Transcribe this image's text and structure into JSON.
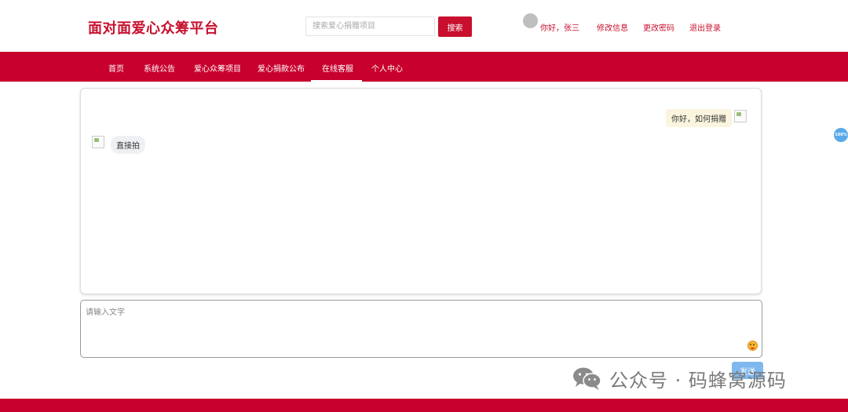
{
  "header": {
    "site_title": "面对面爱心众筹平台",
    "search_placeholder": "搜索爱心捐赠项目",
    "search_button": "搜索",
    "greeting": "你好，张三",
    "edit_info": "修改信息",
    "change_password": "更改密码",
    "logout": "退出登录"
  },
  "nav": {
    "items": [
      "首页",
      "系统公告",
      "爱心众筹项目",
      "爱心捐款公布",
      "在线客服",
      "个人中心"
    ],
    "active": "在线客服"
  },
  "chat": {
    "messages": [
      {
        "side": "right",
        "text": "你好，如何捐赠"
      },
      {
        "side": "left",
        "text": "直接拍"
      }
    ],
    "input_placeholder": "请输入文字",
    "send_button": "发送"
  },
  "float_badge": "100%",
  "watermark": {
    "text": "公众号 · 码蜂窝源码"
  },
  "colors": {
    "brand_red": "#c8002d",
    "send_blue": "#7fb8ef",
    "right_bubble": "#fbf5df",
    "left_bubble": "#eef1f4"
  },
  "icons": [
    "avatar",
    "wechat-icon",
    "emoji-icon",
    "broken-image-icon"
  ]
}
